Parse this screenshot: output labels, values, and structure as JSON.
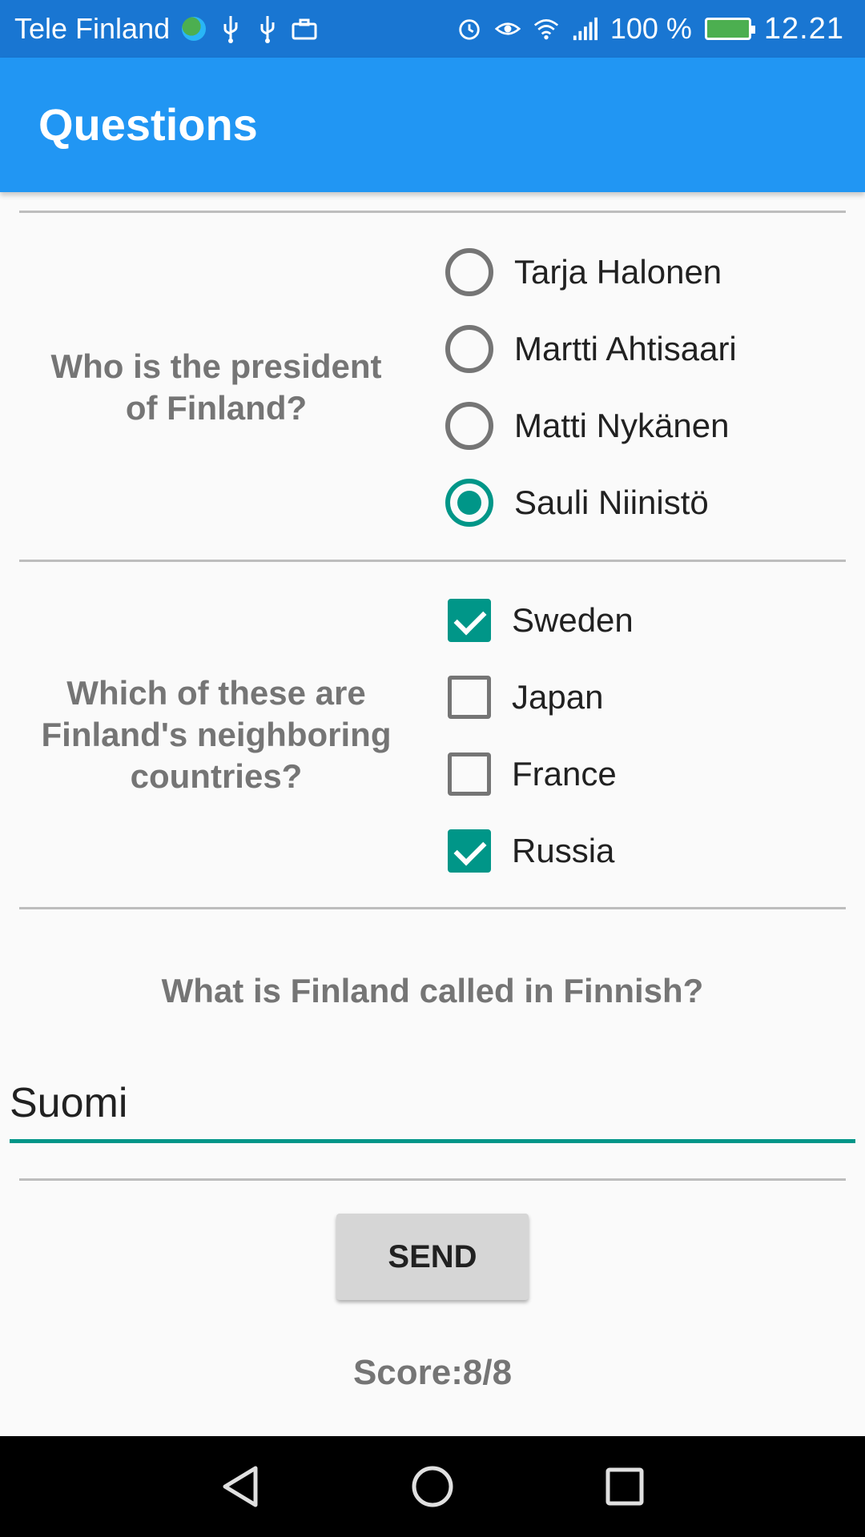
{
  "status_bar": {
    "carrier": "Tele Finland",
    "battery_percent": "100 %",
    "time": "12.21",
    "icons": [
      "globe-icon",
      "usb-icon",
      "usb-icon",
      "briefcase-icon",
      "alarm-icon",
      "eye-icon",
      "wifi-icon",
      "signal-icon",
      "battery-charging-icon"
    ]
  },
  "app_bar": {
    "title": "Questions",
    "color": "#2196f3"
  },
  "questions": {
    "q1": {
      "text": "Who is the president of Finland?",
      "type": "radio",
      "options": [
        {
          "label": "Tarja Halonen",
          "checked": false
        },
        {
          "label": "Martti Ahtisaari",
          "checked": false
        },
        {
          "label": "Matti Nykänen",
          "checked": false
        },
        {
          "label": "Sauli Niinistö",
          "checked": true
        }
      ]
    },
    "q2": {
      "text": "Which of these are Finland's neighboring countries?",
      "type": "checkbox",
      "options": [
        {
          "label": "Sweden",
          "checked": true
        },
        {
          "label": "Japan",
          "checked": false
        },
        {
          "label": "France",
          "checked": false
        },
        {
          "label": "Russia",
          "checked": true
        }
      ]
    },
    "q3": {
      "text": "What is Finland called in Finnish?",
      "type": "text",
      "value": "Suomi"
    }
  },
  "send_button": {
    "label": "SEND"
  },
  "score": {
    "text": "Score:8/8"
  },
  "accent_color": "#009688",
  "nav_bar": {
    "icons": [
      "back-icon",
      "home-icon",
      "recents-icon"
    ]
  }
}
